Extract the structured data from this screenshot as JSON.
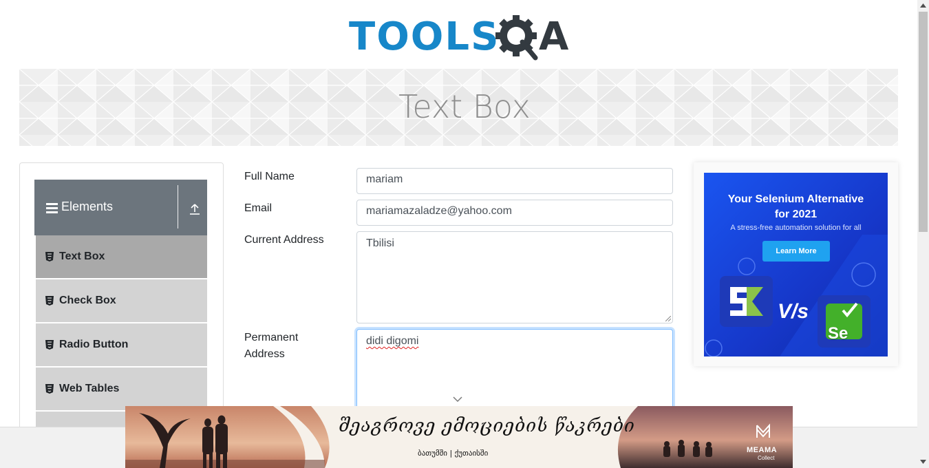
{
  "logo": {
    "tools": "TOOLS",
    "a": "A"
  },
  "banner": {
    "title": "Text Box"
  },
  "sidebar": {
    "group_title": "Elements",
    "items": [
      {
        "label": "Text Box",
        "active": true
      },
      {
        "label": "Check Box",
        "active": false
      },
      {
        "label": "Radio Button",
        "active": false
      },
      {
        "label": "Web Tables",
        "active": false
      }
    ]
  },
  "form": {
    "full_name": {
      "label": "Full Name",
      "value": "mariam"
    },
    "email": {
      "label": "Email",
      "value": "mariamazaladze@yahoo.com"
    },
    "current_address": {
      "label": "Current Address",
      "value": "Tbilisi"
    },
    "permanent_address": {
      "label_line1": "Permanent",
      "label_line2": "Address",
      "value": "didi digomi"
    }
  },
  "ad": {
    "headline_line1": "Your Selenium Alternative",
    "headline_line2": "for 2021",
    "subtitle": "A stress-free automation solution for all",
    "button": "Learn More",
    "vs": "V/s",
    "left_logo_letter": "S",
    "right_logo_text": "Se"
  },
  "bottom_ad": {
    "title": "შეაგროვე ემოციების წაკრები",
    "subtitle": "ბათუმში | ქუთაისში",
    "brand": "MEAMA",
    "brand_sub": "Collect"
  },
  "colors": {
    "brand_blue": "#1787c9",
    "brand_dark": "#333a40",
    "sidebar_header": "#6c757d",
    "menu_item": "#d3d3d3",
    "menu_active": "#a9a9a9",
    "ad_blue": "#1a55f0"
  }
}
